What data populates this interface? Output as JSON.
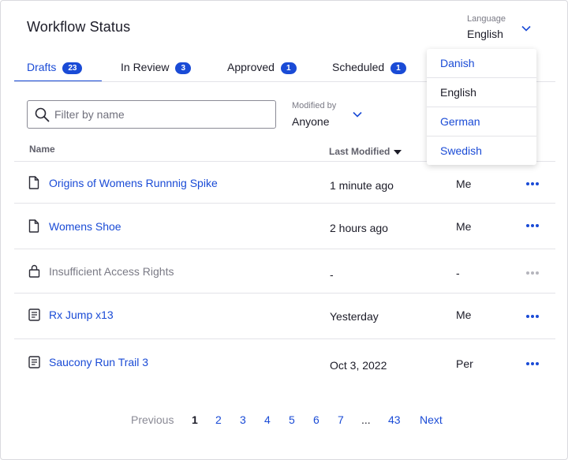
{
  "page": {
    "title": "Workflow Status"
  },
  "language": {
    "label": "Language",
    "value": "English"
  },
  "tabs": [
    {
      "label": "Drafts",
      "count": "23"
    },
    {
      "label": "In Review",
      "count": "3"
    },
    {
      "label": "Approved",
      "count": "1"
    },
    {
      "label": "Scheduled",
      "count": "1"
    }
  ],
  "filter": {
    "placeholder": "Filter by name",
    "value": ""
  },
  "modified_by": {
    "label": "Modified by",
    "value": "Anyone"
  },
  "table": {
    "headers": {
      "name": "Name",
      "last_modified": "Last Modified"
    },
    "rows": [
      {
        "icon": "document-icon",
        "name": "Origins of Womens Runnnig Spike",
        "modified": "1 minute ago",
        "by": "Me"
      },
      {
        "icon": "document-icon",
        "name": "Womens Shoe",
        "modified": "2 hours ago",
        "by": "Me"
      },
      {
        "icon": "lock-icon",
        "name": "Insufficient Access Rights",
        "modified": "-",
        "by": "-"
      },
      {
        "icon": "list-document-icon",
        "name": "Rx Jump x13",
        "modified": "Yesterday",
        "by": "Me"
      },
      {
        "icon": "list-document-icon",
        "name": "Saucony Run Trail 3",
        "modified": "Oct 3, 2022",
        "by": "Per"
      }
    ]
  },
  "pagination": {
    "previous": "Previous",
    "pages": [
      "1",
      "2",
      "3",
      "4",
      "5",
      "6",
      "7"
    ],
    "ellipsis": "...",
    "last": "43",
    "next": "Next",
    "current": "1"
  },
  "language_menu": {
    "options": [
      "Danish",
      "English",
      "German",
      "Swedish"
    ],
    "selected": "English"
  },
  "colors": {
    "accent": "#1a4bd6",
    "text": "#1c1c28",
    "muted": "#7a7a85",
    "divider": "#e3e3e8"
  }
}
